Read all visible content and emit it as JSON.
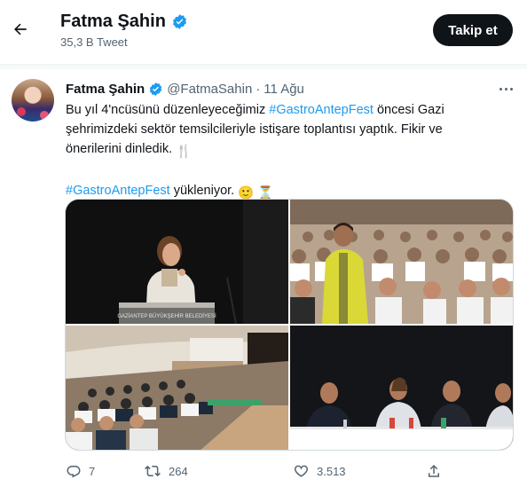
{
  "header": {
    "name": "Fatma Şahin",
    "tweet_count": "35,3 B Tweet",
    "follow_label": "Takip et"
  },
  "tweet": {
    "author_name": "Fatma Şahin",
    "handle": "@FatmaSahin",
    "separator": "·",
    "date": "11 Ağu",
    "text_part1": "Bu yıl 4'ncüsünü düzenleyeceğimiz ",
    "hashtag1": "#GastroAntepFest",
    "text_part2": " öncesi Gazi şehrimizdeki sektör temsilcileriyle istişare toplantısı yaptık. Fikir ve önerilerini dinledik. ",
    "hashtag2": "#GastroAntepFest",
    "text_part3": " yükleniyor. ",
    "emoji_fork": "🍴",
    "emoji_smile": "🙂",
    "emoji_hourglass": "⏳",
    "photo_banner": "GAZİANTEP BÜYÜKŞEHİR BELEDİYESİ"
  },
  "actions": {
    "replies": "7",
    "retweets": "264",
    "likes": "3.513"
  },
  "colors": {
    "accent": "#1d9bf0",
    "text": "#0f1419",
    "muted": "#536471",
    "verified": "#1d9bf0"
  },
  "icons": [
    "back-arrow-icon",
    "verified-badge-icon",
    "more-icon",
    "reply-icon",
    "retweet-icon",
    "like-icon",
    "share-icon"
  ]
}
